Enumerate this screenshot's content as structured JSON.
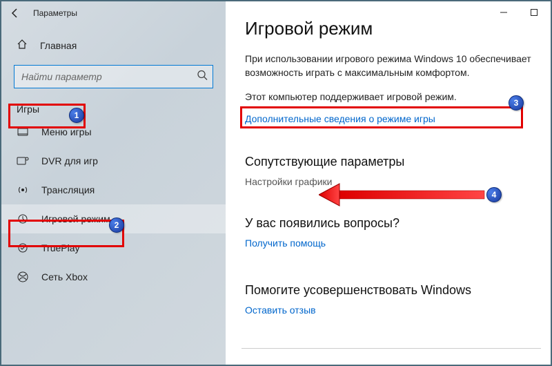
{
  "window": {
    "title": "Параметры",
    "minimize": "—",
    "maximize": "□"
  },
  "home": {
    "label": "Главная"
  },
  "search": {
    "placeholder": "Найти параметр"
  },
  "group": {
    "label": "Игры"
  },
  "nav": [
    {
      "label": "Меню игры",
      "icon": "menu"
    },
    {
      "label": "DVR для игр",
      "icon": "dvr"
    },
    {
      "label": "Трансляция",
      "icon": "broadcast"
    },
    {
      "label": "Игровой режим",
      "icon": "gamemode",
      "active": true
    },
    {
      "label": "TruePlay",
      "icon": "trueplay"
    },
    {
      "label": "Сеть Xbox",
      "icon": "xbox"
    }
  ],
  "main": {
    "heading": "Игровой режим",
    "desc": "При использовании игрового режима Windows 10 обеспечивает возможность играть с максимальным комфортом.",
    "support": "Этот компьютер поддерживает игровой режим.",
    "learn_more": "Дополнительные сведения о режиме игры",
    "related_heading": "Сопутствующие параметры",
    "graphics": "Настройки графики",
    "questions_heading": "У вас появились вопросы?",
    "help": "Получить помощь",
    "improve_heading": "Помогите усовершенствовать Windows",
    "feedback": "Оставить отзыв"
  },
  "badges": {
    "b1": "1",
    "b2": "2",
    "b3": "3",
    "b4": "4"
  }
}
